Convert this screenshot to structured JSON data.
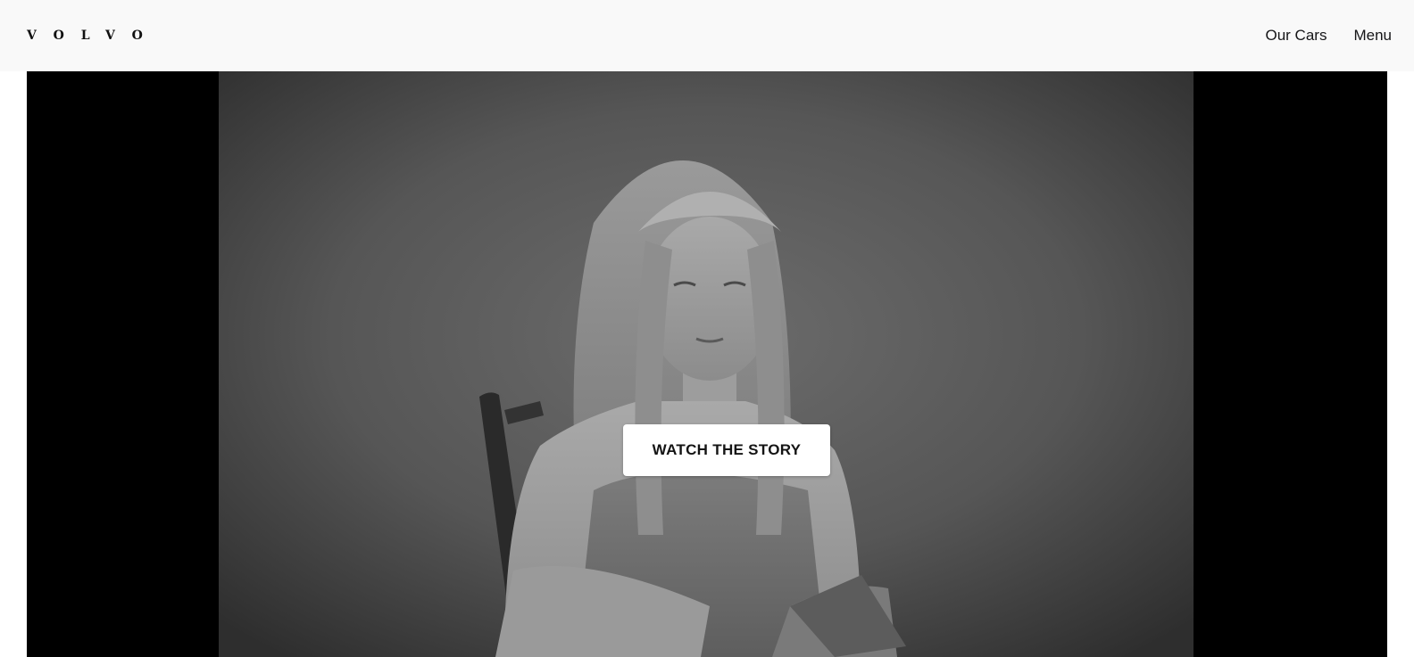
{
  "header": {
    "logo_text": "VOLVO",
    "nav": {
      "our_cars": "Our Cars",
      "menu": "Menu"
    }
  },
  "hero": {
    "cta_label": "WATCH THE STORY",
    "media_description_colors": {
      "letterbox": "#000000",
      "header_bg": "#f9f9f9"
    }
  }
}
